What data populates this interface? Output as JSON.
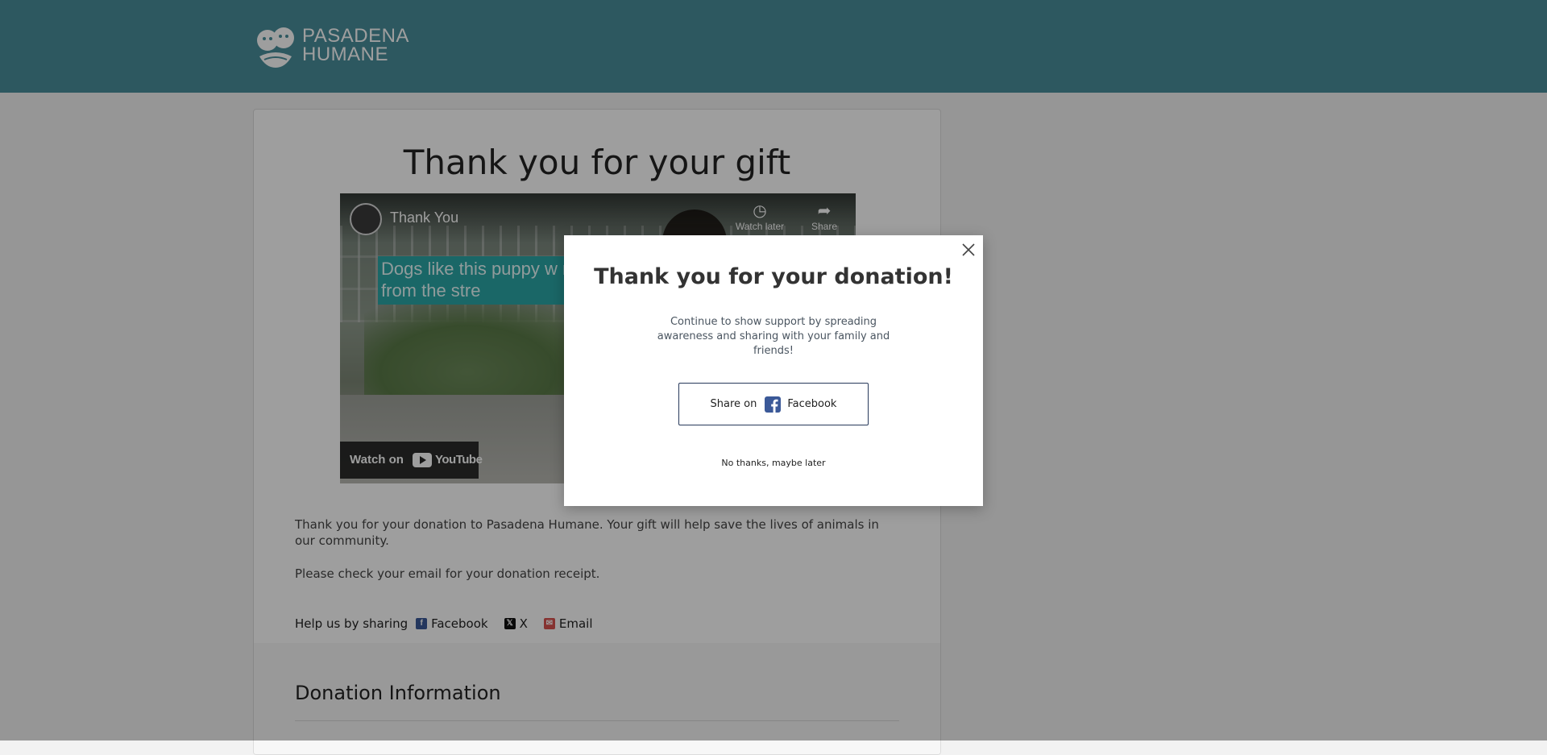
{
  "header": {
    "logo_line1": "PASADENA",
    "logo_line2": "HUMANE",
    "bg_color": "#4a8f9c"
  },
  "main": {
    "title": "Thank you for your gift",
    "video": {
      "title": "Thank You",
      "caption": "Dogs like this puppy w rescued from the stre",
      "watch_later": "Watch later",
      "share": "Share",
      "watch_on": "Watch on",
      "youtube": "YouTube"
    },
    "paragraph1": "Thank you for your donation to Pasadena Humane. Your gift will help save the lives of animals in our community.",
    "paragraph2": "Please check your email for your donation receipt.",
    "share": {
      "label": "Help us by sharing",
      "facebook": "Facebook",
      "x": "X",
      "email": "Email"
    },
    "section_title": "Donation Information"
  },
  "modal": {
    "title": "Thank you for your donation!",
    "body": "Continue to show support by spreading awareness and sharing with your family and friends!",
    "share_prefix": "Share on",
    "share_network": "Facebook",
    "dismiss": "No thanks, maybe later"
  },
  "icons": {
    "facebook_color": "#3b5998",
    "x_color": "#111111",
    "email_color": "#d9534f"
  }
}
